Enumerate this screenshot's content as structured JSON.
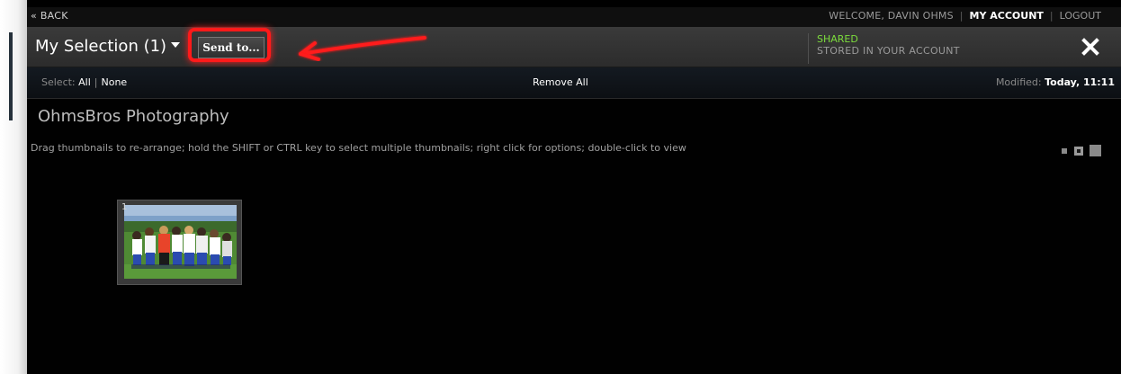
{
  "top_nav": {
    "back": "« BACK",
    "welcome": "WELCOME, DAVIN OHMS",
    "my_account": "MY ACCOUNT",
    "logout": "LOGOUT",
    "separator": "|"
  },
  "header": {
    "selection_title": "My Selection (1)",
    "send_button": "Send to...",
    "status_shared": "SHARED",
    "status_stored": "STORED IN YOUR ACCOUNT",
    "highlight_color": "#ff1a1a"
  },
  "toolbar": {
    "select_label": "Select:",
    "select_all": "All",
    "select_divider": "|",
    "select_none": "None",
    "remove_all": "Remove All",
    "modified_label": "Modified:",
    "modified_value": "Today, 11:11"
  },
  "gallery": {
    "title": "OhmsBros Photography",
    "instructions": "Drag thumbnails to re-arrange; hold the SHIFT or CTRL key to select multiple thumbnails; right click for options; double-click to view",
    "thumbnails": [
      {
        "number": "1",
        "description": "team photo"
      }
    ]
  },
  "icons": {
    "close": "close-icon",
    "caret": "chevron-down-icon",
    "arrow": "red-annotation-arrow",
    "size_small": "thumb-size-small-icon",
    "size_medium": "thumb-size-medium-icon",
    "size_large": "thumb-size-large-icon"
  },
  "colors": {
    "accent_green": "#7cdc3c",
    "annotation_red": "#ff1a1a",
    "background": "#000000"
  }
}
